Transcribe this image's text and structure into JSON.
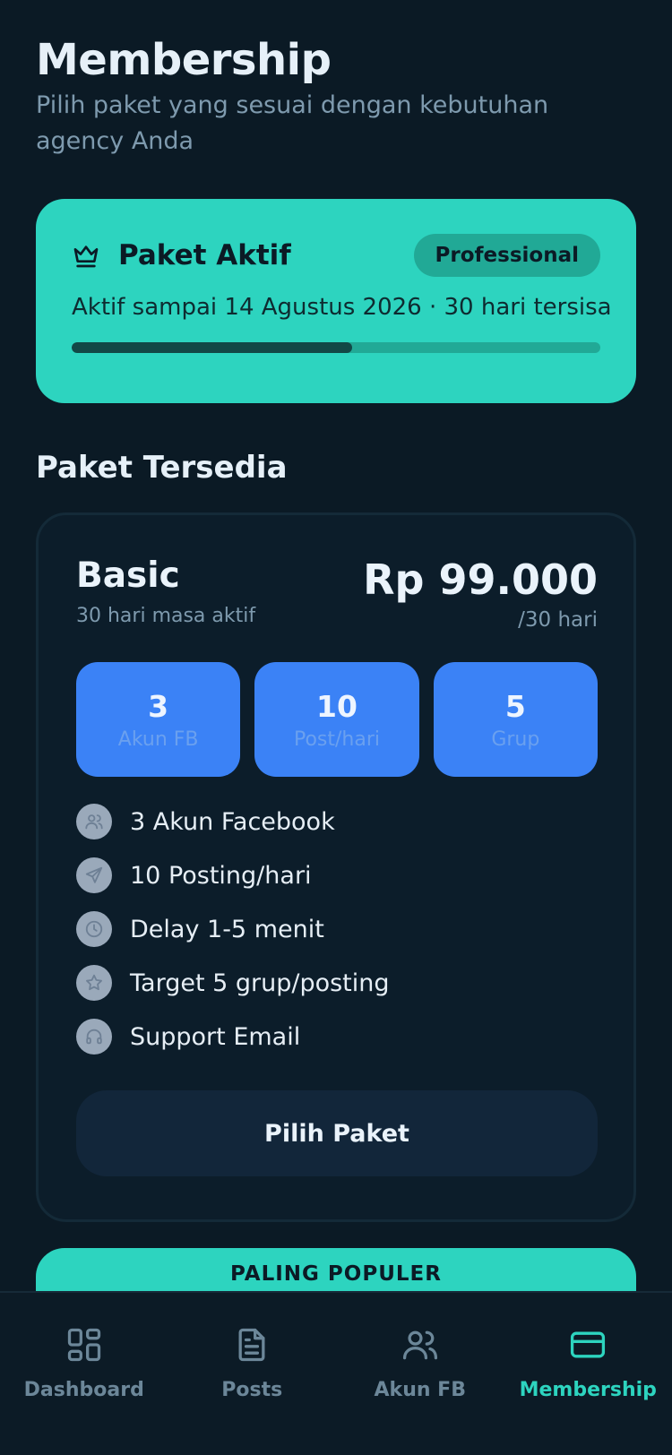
{
  "header": {
    "title": "Membership",
    "subtitle": "Pilih paket yang sesuai dengan kebutuhan agency Anda"
  },
  "active_plan": {
    "title": "Paket Aktif",
    "badge": "Professional",
    "info": "Aktif sampai 14 Agustus 2026 · 30 hari tersisa",
    "progress_fraction": 0.53,
    "icon": "crown-icon"
  },
  "available": {
    "section_title": "Paket Tersedia"
  },
  "plan": {
    "name": "Basic",
    "duration": "30 hari masa aktif",
    "price": "Rp 99.000",
    "period": "/30 hari",
    "stats": [
      {
        "value": "3",
        "label": "Akun FB"
      },
      {
        "value": "10",
        "label": "Post/hari"
      },
      {
        "value": "5",
        "label": "Grup"
      }
    ],
    "features": [
      {
        "icon": "users-icon",
        "text": "3 Akun Facebook"
      },
      {
        "icon": "send-icon",
        "text": "10 Posting/hari"
      },
      {
        "icon": "clock-icon",
        "text": "Delay 1-5 menit"
      },
      {
        "icon": "star-icon",
        "text": "Target 5 grup/posting"
      },
      {
        "icon": "headset-icon",
        "text": "Support Email"
      }
    ],
    "button_label": "Pilih Paket"
  },
  "popular": {
    "label": "PALING POPULER"
  },
  "nav": {
    "items": [
      {
        "label": "Dashboard",
        "icon": "dashboard-icon",
        "active": false
      },
      {
        "label": "Posts",
        "icon": "document-icon",
        "active": false
      },
      {
        "label": "Akun FB",
        "icon": "users-icon",
        "active": false
      },
      {
        "label": "Membership",
        "icon": "card-icon",
        "active": true
      }
    ]
  },
  "colors": {
    "background": "#0b1a25",
    "accent": "#2dd4bf",
    "stat_blue": "#3b82f6",
    "muted": "#7e9aae"
  }
}
